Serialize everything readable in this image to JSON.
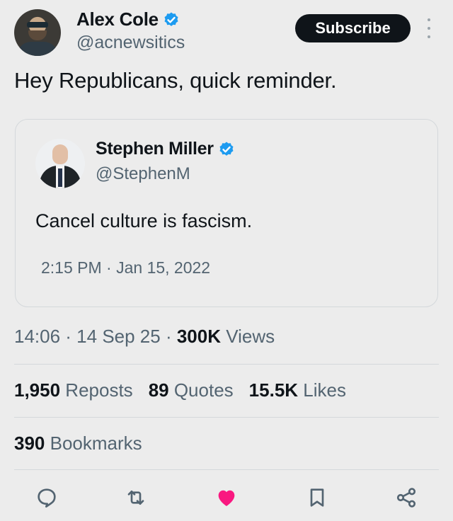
{
  "author": {
    "name": "Alex Cole",
    "handle": "@acnewsitics"
  },
  "subscribe_label": "Subscribe",
  "tweet_text": "Hey Republicans, quick reminder.",
  "quoted": {
    "name": "Stephen Miller",
    "handle": "@StephenM",
    "text": "Cancel culture is fascism.",
    "time": "2:15 PM · Jan 15, 2022"
  },
  "meta": {
    "time": "14:06 · 14 Sep 25 · ",
    "views_count": "300K",
    "views_label": " Views"
  },
  "stats": {
    "reposts_count": "1,950",
    "reposts_label": " Reposts",
    "quotes_count": "89",
    "quotes_label": " Quotes",
    "likes_count": "15.5K",
    "likes_label": " Likes",
    "bookmarks_count": "390",
    "bookmarks_label": " Bookmarks"
  },
  "colors": {
    "verified": "#1d9bf0",
    "like": "#f91880",
    "icon": "#536471"
  },
  "icons": [
    "verified-badge-icon",
    "more-icon",
    "reply-icon",
    "repost-icon",
    "like-icon",
    "bookmark-icon",
    "share-icon"
  ]
}
